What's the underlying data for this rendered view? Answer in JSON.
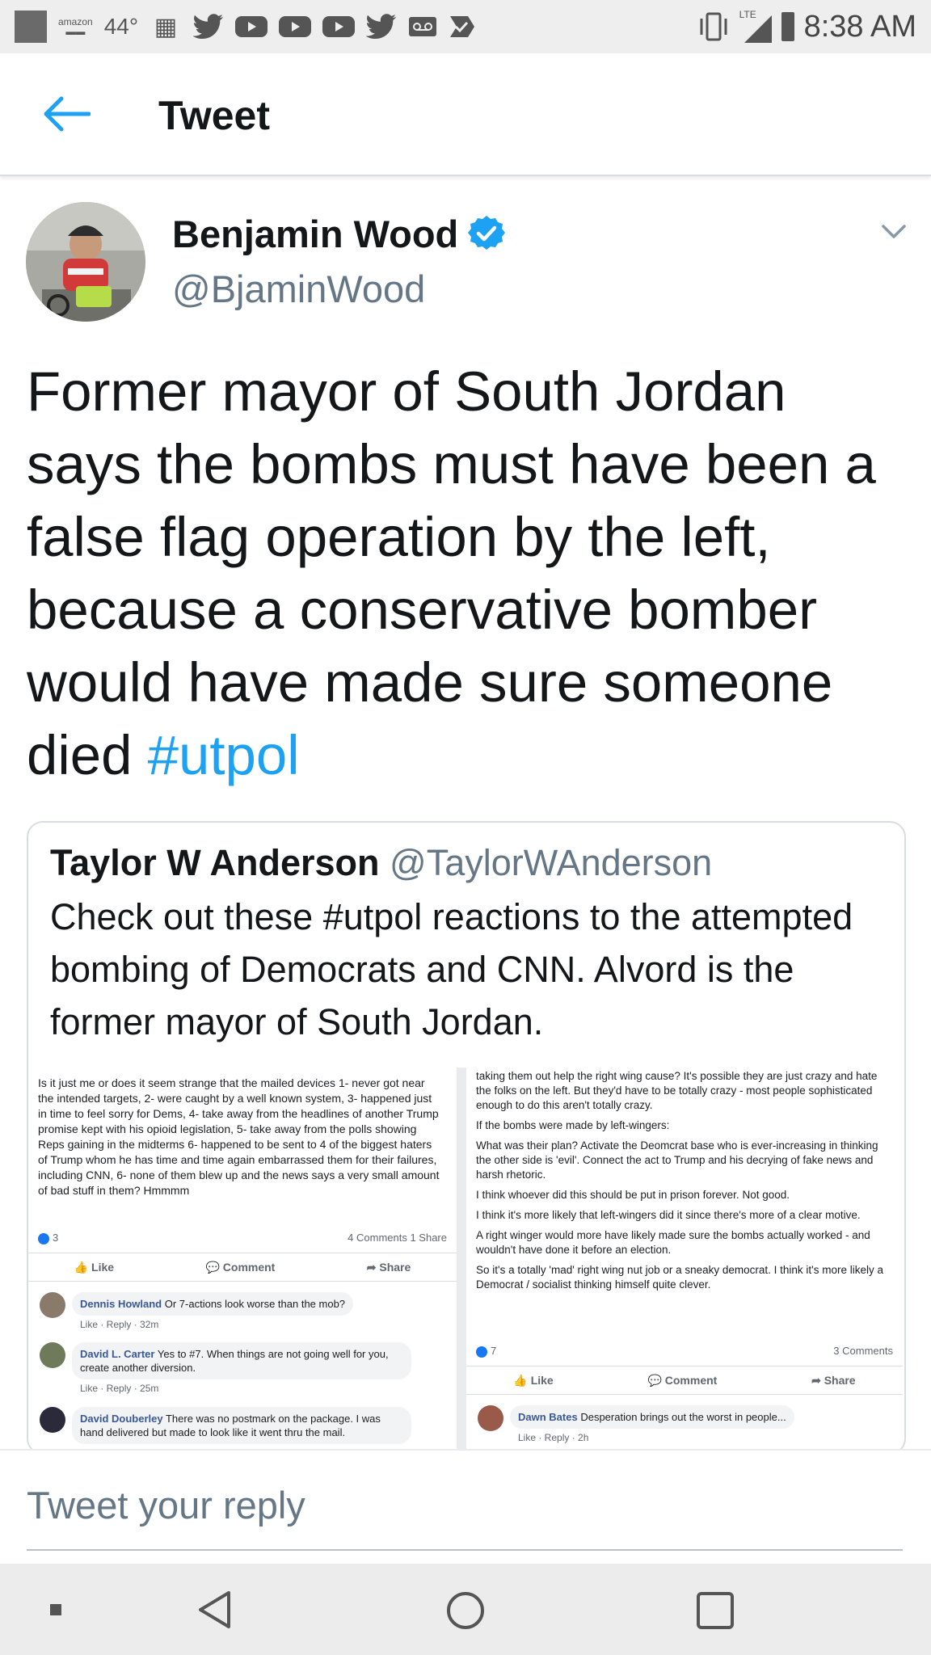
{
  "status_bar": {
    "temperature": "44°",
    "amazon_label": "amazon",
    "network": "LTE",
    "time": "8:38 AM",
    "icons": [
      "photo-icon",
      "amazon-icon",
      "temperature-text",
      "chat-icon",
      "twitter-icon",
      "youtube-icon",
      "youtube-icon",
      "youtube-icon",
      "twitter-icon",
      "voicemail-icon",
      "check-icon",
      "vibrate-icon",
      "signal-icon",
      "battery-icon"
    ]
  },
  "header": {
    "title": "Tweet",
    "back_icon": "back-arrow-icon"
  },
  "tweet": {
    "author_name": "Benjamin Wood",
    "author_handle": "@BjaminWood",
    "verified": true,
    "text": "Former mayor of South Jordan says the bombs must have been a false flag operation by the left, because a conservative bomber would have made sure someone died ",
    "hashtag": "#utpol",
    "colors": {
      "link": "#1da1f2",
      "secondary": "#657786",
      "text": "#14171a"
    }
  },
  "quote": {
    "author_name": "Taylor W Anderson",
    "author_handle": "@TaylorWAnderson",
    "text": "Check out these #utpol reactions to the attempted bombing of Democrats and CNN. Alvord is the former mayor of South Jordan.",
    "left_post": {
      "text": "Is it just me or does it seem strange that the mailed devices 1- never got near the intended targets, 2- were caught by a well known system, 3- happened just in time to feel sorry for Dems, 4- take away from the headlines of another Trump promise kept with his opioid legislation, 5- take away from the polls showing Reps gaining in the midterms 6- happened to be sent to 4 of the biggest haters of Trump whom he has time and time again embarrassed them for their failures, including CNN, 6- none of them blew up and the news says a very small amount of bad stuff in them? Hmmmm",
      "likes": "3",
      "comments_shares": "4 Comments  1 Share",
      "actions": [
        "Like",
        "Comment",
        "Share"
      ],
      "comments": [
        {
          "name": "Dennis Howland",
          "text": "Or 7-actions look worse than the mob?",
          "meta": "Like · Reply · 32m"
        },
        {
          "name": "David L. Carter",
          "text": "Yes to #7. When things are not going well for you, create another diversion.",
          "meta": "Like · Reply · 25m"
        },
        {
          "name": "David Douberley",
          "text": "There was no postmark on the package. I was hand delivered but made to look like it went thru the mail.",
          "meta": ""
        }
      ]
    },
    "right_post": {
      "paragraphs": [
        "taking them out help the right wing cause? It's possible they are just crazy and hate the folks on the left. But they'd have to be totally crazy - most people sophisticated enough to do this aren't totally crazy.",
        "If the bombs were made by left-wingers:",
        "What was their plan? Activate the Deomcrat base who is ever-increasing in thinking the other side is 'evil'. Connect the act to Trump and his decrying of fake news and harsh rhetoric.",
        "I think whoever did this should be put in prison forever. Not good.",
        "I think it's more likely that left-wingers did it since there's more of a clear motive.",
        "A right winger would more have likely made sure the bombs actually worked - and wouldn't have done it before an election.",
        "So it's a totally 'mad' right wing nut job or a sneaky democrat. I think it's more likely a Democrat / socialist thinking himself quite clever."
      ],
      "likes": "7",
      "comments_count": "3 Comments",
      "actions": [
        "Like",
        "Comment",
        "Share"
      ],
      "comments": [
        {
          "name": "Dawn Bates",
          "text": "Desperation brings out the worst in people...",
          "meta": "Like · Reply · 2h"
        }
      ]
    }
  },
  "reply": {
    "placeholder": "Tweet your reply"
  },
  "nav": {
    "icons": [
      "recents-dot-icon",
      "back-triangle-icon",
      "home-circle-icon",
      "overview-square-icon"
    ]
  }
}
